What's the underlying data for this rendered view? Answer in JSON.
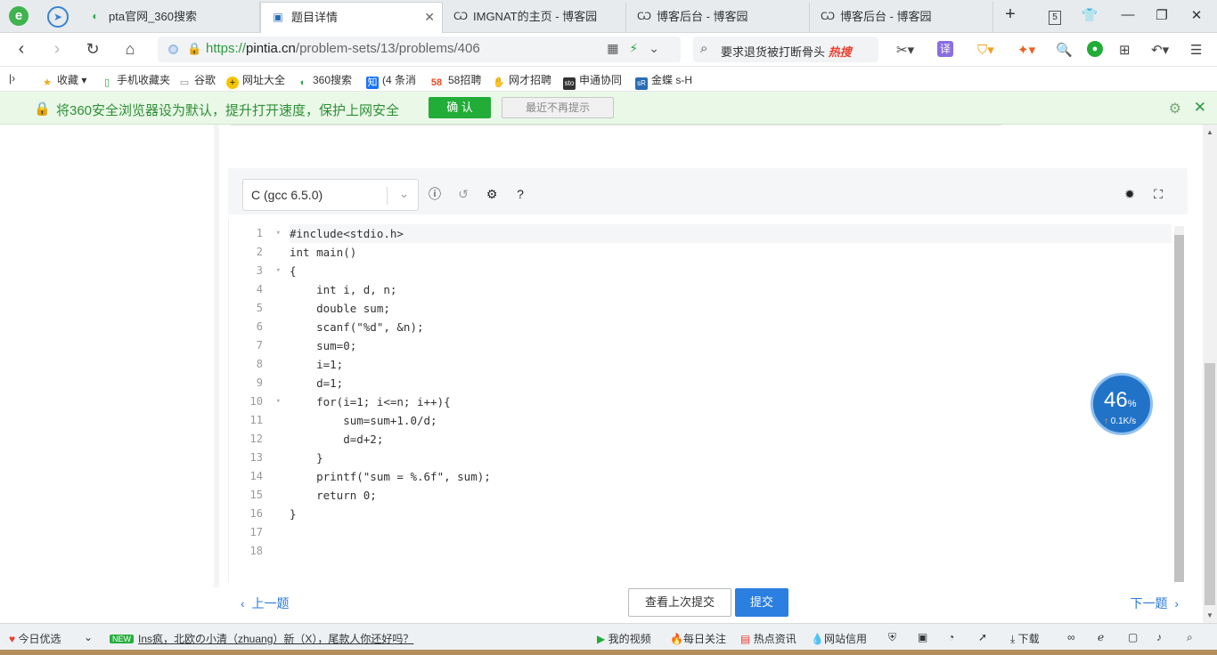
{
  "browser": {
    "tabs": [
      {
        "title": "pta官网_360搜索",
        "icon": "360-search-icon"
      },
      {
        "title": "题目详情",
        "icon": "pta-page-icon",
        "active": true
      },
      {
        "title": "IMGNAT的主页 - 博客园",
        "icon": "cnblogs-icon"
      },
      {
        "title": "博客后台 - 博客园",
        "icon": "cnblogs-icon"
      },
      {
        "title": "博客后台 - 博客园",
        "icon": "cnblogs-icon"
      }
    ],
    "tab_count": "5",
    "url_scheme": "https://",
    "url_host": "pintia.cn",
    "url_path": "/problem-sets/13/problems/406",
    "search_text": "要求退货被打断骨头",
    "search_hot": "热搜",
    "bookmarks": [
      "收藏",
      "手机收藏夹",
      "谷歌",
      "网址大全",
      "360搜索",
      "(4 条消",
      "58招聘",
      "网才招聘",
      "申通协同",
      "金蝶 s-H"
    ],
    "notification": {
      "text": "将360安全浏览器设为默认，提升打开速度，保护上网安全",
      "confirm": "确 认",
      "dismiss": "最近不再提示"
    }
  },
  "editor": {
    "language": "C (gcc 6.5.0)",
    "code_lines": [
      "#include<stdio.h>",
      "int main()",
      "{",
      "    int i, d, n;",
      "    double sum;",
      "    scanf(\"%d\", &n);",
      "    sum=0;",
      "    i=1;",
      "    d=1;",
      "    for(i=1; i<=n; i++){",
      "        sum=sum+1.0/d;",
      "        d=d+2;",
      "    }",
      "    printf(\"sum = %.6f\", sum);",
      "    return 0;",
      "}",
      "",
      ""
    ],
    "line_numbers": [
      "1",
      "2",
      "3",
      "4",
      "5",
      "6",
      "7",
      "8",
      "9",
      "10",
      "11",
      "12",
      "13",
      "14",
      "15",
      "16",
      "17",
      "18"
    ],
    "prev_label": "上一题",
    "last_submission_label": "查看上次提交",
    "submit_label": "提交",
    "next_label": "下一题"
  },
  "speed_widget": {
    "percent": "46",
    "unit": "%",
    "rate": "0.1K/s"
  },
  "statusbar": {
    "today": "今日优选",
    "new_tag": "NEW",
    "news": "Ins疯，北欧の小清（zhuang）新（X），尾款人你还好吗？",
    "items": [
      "我的视频",
      "每日关注",
      "热点资讯",
      "网站信用",
      "下载"
    ]
  },
  "colors": {
    "accent_green": "#22ac38",
    "link_blue": "#2a7ad9",
    "submit_blue": "#2a7fe0"
  }
}
